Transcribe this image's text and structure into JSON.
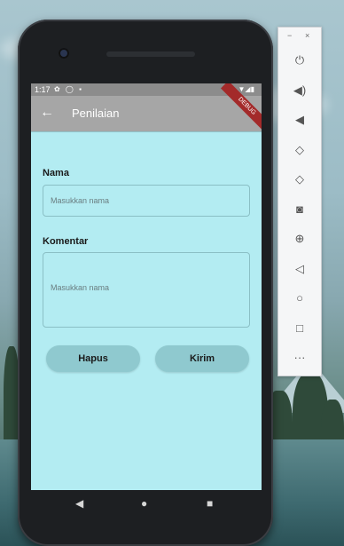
{
  "status_bar": {
    "time": "1:17",
    "left_icons": "✿ ◯ ▪",
    "right_icons": "▼◢▮"
  },
  "app_bar": {
    "back_icon": "←",
    "title": "Penilaian",
    "debug_banner": "DEBUG"
  },
  "form": {
    "name_label": "Nama",
    "name_placeholder": "Masukkan nama",
    "comment_label": "Komentar",
    "comment_placeholder": "Masukkan nama",
    "clear_button": "Hapus",
    "submit_button": "Kirim"
  },
  "navigation": {
    "back": "◀",
    "home": "●",
    "recents": "■"
  },
  "emulator_panel": {
    "minimize": "−",
    "close": "×",
    "tools": [
      {
        "name": "power-icon",
        "glyph": "⏻"
      },
      {
        "name": "volume-up-icon",
        "glyph": "◀)"
      },
      {
        "name": "volume-down-icon",
        "glyph": "◀"
      },
      {
        "name": "rotate-left-icon",
        "glyph": "◇"
      },
      {
        "name": "rotate-right-icon",
        "glyph": "◇"
      },
      {
        "name": "camera-icon",
        "glyph": "◙"
      },
      {
        "name": "zoom-icon",
        "glyph": "⊕"
      },
      {
        "name": "back-icon",
        "glyph": "◁"
      },
      {
        "name": "home-icon",
        "glyph": "○"
      },
      {
        "name": "overview-icon",
        "glyph": "□"
      },
      {
        "name": "more-icon",
        "glyph": "···"
      }
    ]
  }
}
